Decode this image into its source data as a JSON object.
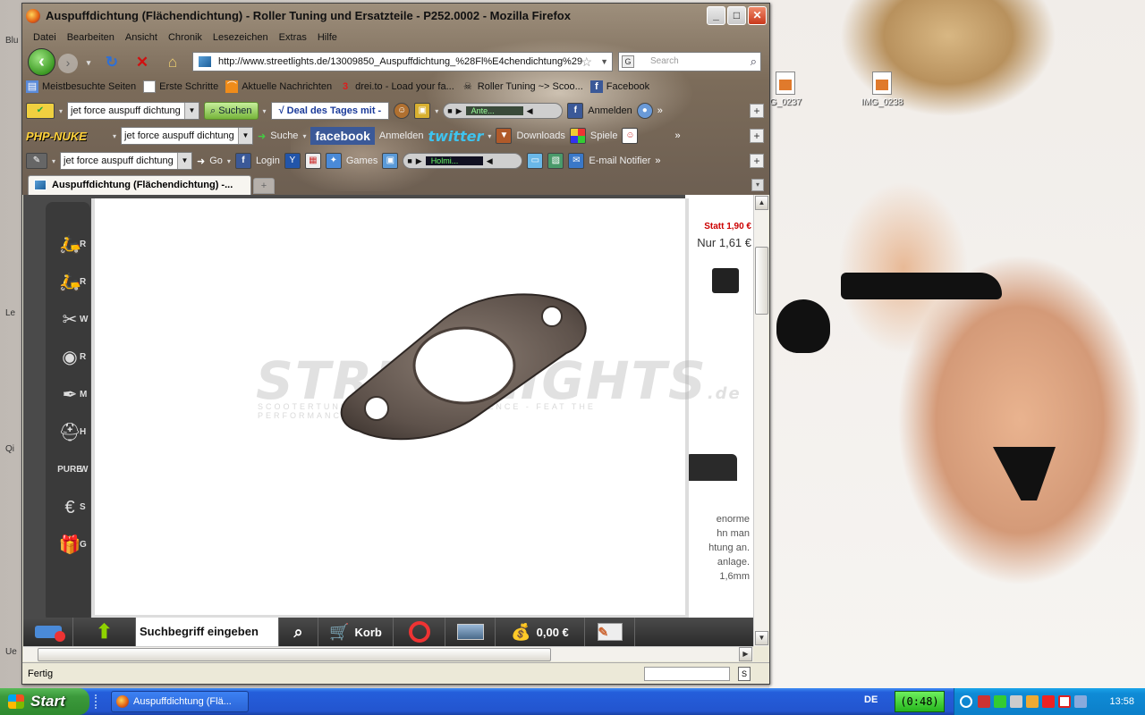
{
  "desktop": {
    "icons": [
      {
        "label": "G_0237"
      },
      {
        "label": "IMG_0238"
      }
    ],
    "left_labels": [
      "Blu",
      "Le",
      "Qi",
      "Ue"
    ]
  },
  "window": {
    "title": "Auspuffdichtung (Flächendichtung) - Roller Tuning und Ersatzteile - P252.0002 - Mozilla Firefox",
    "menu": [
      "Datei",
      "Bearbeiten",
      "Ansicht",
      "Chronik",
      "Lesezeichen",
      "Extras",
      "Hilfe"
    ],
    "url": "http://www.streetlights.de/13009850_Auspuffdichtung_%28Fl%E4chendichtung%29",
    "search_placeholder": "Search",
    "bookmarks": [
      "Meistbesuchte Seiten",
      "Erste Schritte",
      "Aktuelle Nachrichten",
      "drei.to - Load your fa...",
      "Roller Tuning ~> Scoo...",
      "Facebook"
    ],
    "toolbar1": {
      "query": "jet force auspuff dichtung",
      "search_button": "Suchen",
      "deal": "√ Deal des Tages mit -",
      "player": "Ante...",
      "login": "Anmelden"
    },
    "toolbar2": {
      "logo": "PHP-NUKE",
      "query": "jet force auspuff dichtung",
      "search": "Suche",
      "facebook": "facebook",
      "login": "Anmelden",
      "twitter": "twitter",
      "downloads": "Downloads",
      "games": "Spiele"
    },
    "toolbar3": {
      "query": "jet force auspuff dichtung",
      "go": "Go",
      "login": "Login",
      "games": "Games",
      "player": "Holmi...",
      "email": "E-mail Notifier"
    },
    "tab_title": "Auspuffdichtung (Flächendichtung) -...",
    "status": "Fertig"
  },
  "page": {
    "price_old": "Statt 1,90 €",
    "price_new": "Nur 1,61 €",
    "text_lines": [
      "enorme",
      "hn man",
      "htung an.",
      "anlage.",
      "1,6mm"
    ],
    "watermark": "STREETLIGHTS",
    "watermark_suffix": ".de",
    "watermark_tagline": "SCOOTERTUNING - FEEL THE DIFFERENCE - FEAT THE PERFORMANCE",
    "sidebar_letters": [
      "R",
      "R",
      "W",
      "R",
      "M",
      "H",
      "W",
      "S",
      "G"
    ]
  },
  "bottom_bar": {
    "search_placeholder": "Suchbegriff eingeben",
    "cart": "Korb",
    "amount": "0,00 €"
  },
  "taskbar": {
    "start": "Start",
    "task": "Auspuffdichtung (Flä...",
    "lang": "DE",
    "timer": "(0:48)",
    "clock": "13:58"
  },
  "colors": {
    "taskbar": "#245edb",
    "start": "#3c9a3c",
    "accent_green": "#76b43a",
    "price_red": "#cc0000"
  }
}
